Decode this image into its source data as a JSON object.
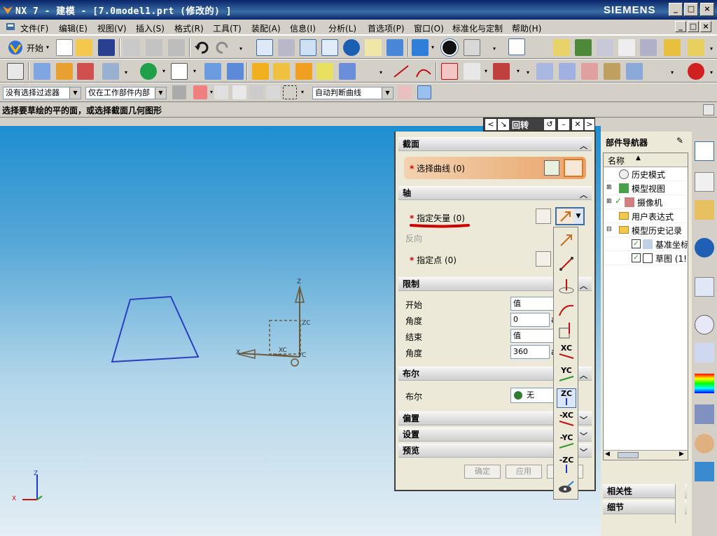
{
  "titlebar": {
    "title": "NX 7 - 建模 - [7.0model1.prt (修改的) ]",
    "brand": "SIEMENS"
  },
  "menubar": {
    "items": [
      "文件(F)",
      "编辑(E)",
      "视图(V)",
      "插入(S)",
      "格式(R)",
      "工具(T)",
      "装配(A)",
      "信息(I)",
      "分析(L)",
      "首选项(P)",
      "窗口(O)",
      "标准化与定制",
      "帮助(H)"
    ]
  },
  "toolbar": {
    "start_label": "开始"
  },
  "selection": {
    "filter": "没有选择过滤器",
    "scope": "仅在工作部件内部",
    "curve_rule": "自动判断曲线"
  },
  "cue": {
    "text": "选择要草绘的平的面，或选择截面几何图形"
  },
  "dialog": {
    "title": "回转",
    "section": {
      "header": "截面",
      "select_curve": "选择曲线",
      "select_curve_count": "(0)"
    },
    "axis": {
      "header": "轴",
      "specify_vector": "指定矢量",
      "specify_vector_count": "(0)",
      "reverse": "反向",
      "specify_point": "指定点",
      "specify_point_count": "(0)"
    },
    "limits": {
      "header": "限制",
      "start_label": "开始",
      "start_value": "值",
      "angle1_label": "角度",
      "angle1_value": "0",
      "end_label": "结束",
      "end_value": "值",
      "angle2_label": "角度",
      "angle2_value": "360",
      "unit": "a"
    },
    "boolean": {
      "header": "布尔",
      "label": "布尔",
      "value": "无"
    },
    "offset": {
      "header": "偏置"
    },
    "settings": {
      "header": "设置"
    },
    "preview": {
      "header": "预览"
    },
    "buttons": {
      "ok": "确定",
      "apply": "应用"
    }
  },
  "vector_popup": {
    "items": [
      "XC",
      "YC",
      "ZC",
      "-XC",
      "-YC",
      "-ZC"
    ]
  },
  "viewport": {
    "triad_labels": {
      "z": "Z",
      "zc": "ZC",
      "x": "X",
      "xc": "XC",
      "yc": "YC"
    }
  },
  "part_navigator": {
    "header": "部件导航器",
    "column": "名称",
    "rows": [
      {
        "label": "历史模式"
      },
      {
        "label": "模型视图"
      },
      {
        "label": "摄像机"
      },
      {
        "label": "用户表达式"
      },
      {
        "label": "模型历史记录"
      },
      {
        "label": "基准坐标"
      },
      {
        "label": "草图 (1!"
      }
    ],
    "bottom": [
      "相关性",
      "细节"
    ]
  },
  "colors": {
    "accent": "#0a246a",
    "required_star": "#cc0000",
    "annotation": "#cc0000",
    "sketch_blue": "#2a3fc0"
  }
}
